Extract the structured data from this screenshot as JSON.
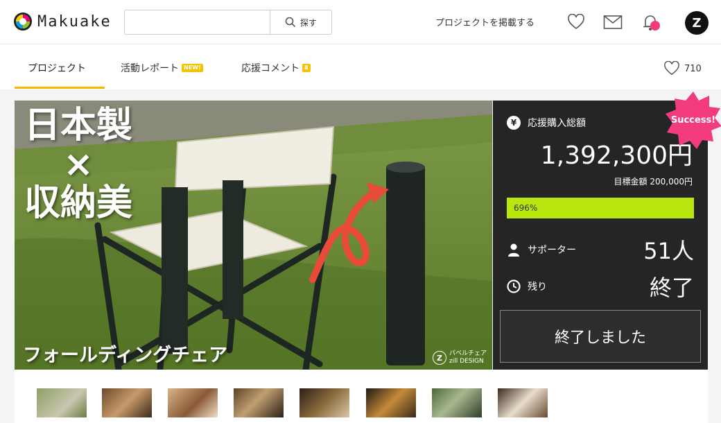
{
  "header": {
    "logo_text": "Makuake",
    "search_placeholder": "",
    "search_button": "探す",
    "post_project": "プロジェクトを掲載する",
    "avatar_letter": "Z"
  },
  "tabs": [
    {
      "label": "プロジェクト"
    },
    {
      "label": "活動レポート",
      "badge": "NEW!"
    },
    {
      "label": "応援コメント",
      "badge": "8"
    }
  ],
  "likes_count": "710",
  "hero": {
    "title": "日本製\n×\n収納美",
    "subtitle": "フォールディングチェア",
    "brand_line1": "パベルチェア",
    "brand_line2": "zill DESIGN"
  },
  "panel": {
    "total_label": "応援購入総額",
    "amount": "1,392,300円",
    "goal": "目標金額 200,000円",
    "progress_label": "696%",
    "progress_percent": 696,
    "supporters_label": "サポーター",
    "supporters_value": "51人",
    "remaining_label": "残り",
    "remaining_value": "終了",
    "ended_button": "終了しました",
    "success_badge": "Success!"
  },
  "colors": {
    "accent": "#f5b800",
    "progress": "#b8e60e",
    "success": "#f23c7f",
    "panel_bg": "#252525"
  },
  "thumbnails": [
    {
      "thumb_text": ""
    },
    {
      "thumb_text": ""
    },
    {
      "thumb_text": ""
    },
    {
      "thumb_text": ""
    },
    {
      "thumb_text": ""
    },
    {
      "thumb_text": ""
    },
    {
      "thumb_text": ""
    },
    {
      "thumb_text": ""
    }
  ]
}
